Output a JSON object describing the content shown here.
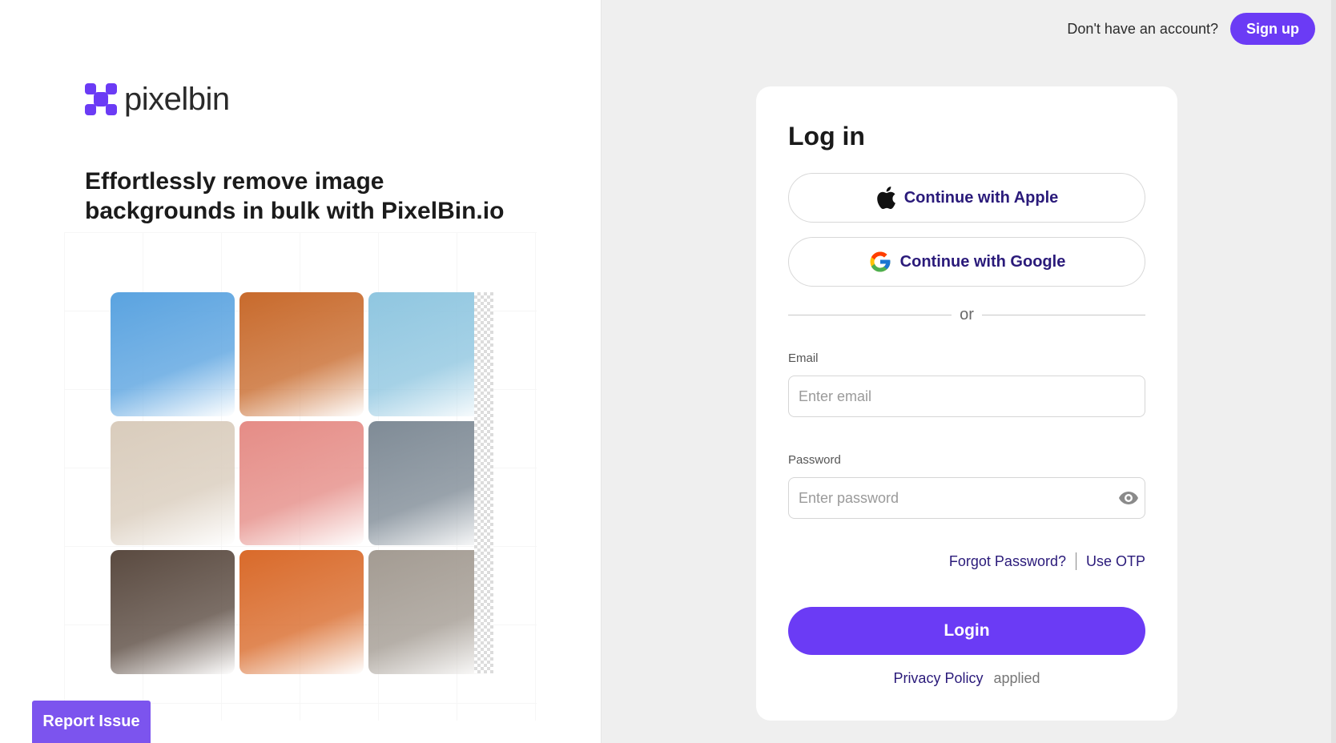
{
  "brand": {
    "name": "pixelbin",
    "accent": "#6b3bf5"
  },
  "hero": {
    "headline": "Effortlessly remove image backgrounds in bulk with PixelBin.io"
  },
  "gallery": {
    "tiles": [
      {
        "name": "blue-high-heel-image",
        "color": "#5aa3e0"
      },
      {
        "name": "white-sofa-image",
        "color": "#c86a2c"
      },
      {
        "name": "yellow-outfit-woman-image",
        "color": "#8fc6e0"
      },
      {
        "name": "poodle-dog-image",
        "color": "#d9ccbc"
      },
      {
        "name": "woman-white-hat-image",
        "color": "#e58c86"
      },
      {
        "name": "vintage-car-image",
        "color": "#7f8b96"
      },
      {
        "name": "man-sunglasses-image",
        "color": "#5a4a40"
      },
      {
        "name": "orange-headphones-image",
        "color": "#d96a2a"
      },
      {
        "name": "brown-handbag-image",
        "color": "#a39b92"
      }
    ]
  },
  "report_issue": {
    "label": "Report Issue"
  },
  "header": {
    "prompt_text": "Don't have an account?",
    "signup_label": "Sign up"
  },
  "login": {
    "title": "Log in",
    "apple_label": "Continue with Apple",
    "google_label": "Continue with Google",
    "divider_text": "or",
    "email_label": "Email",
    "email_placeholder": "Enter email",
    "password_label": "Password",
    "password_placeholder": "Enter password",
    "forgot_label": "Forgot Password?",
    "otp_label": "Use OTP",
    "submit_label": "Login",
    "privacy_label": "Privacy Policy",
    "applied_text": "applied"
  }
}
